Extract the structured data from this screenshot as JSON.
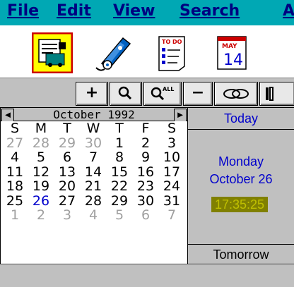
{
  "menu": {
    "items": [
      {
        "label": "File"
      },
      {
        "label": "Edit"
      },
      {
        "label": "View"
      },
      {
        "label": "Search"
      },
      {
        "label": "A"
      }
    ]
  },
  "icons": [
    {
      "name": "scheduler-icon",
      "selected": true
    },
    {
      "name": "phone-book-icon",
      "selected": false
    },
    {
      "name": "todo-list-icon",
      "label": "TO DO",
      "selected": false
    },
    {
      "name": "calendar-page-icon",
      "label_top": "MAY",
      "label_day": "14",
      "selected": false
    }
  ],
  "toolbar": {
    "buttons": [
      {
        "name": "add-button",
        "glyph": "+"
      },
      {
        "name": "find-button",
        "glyph": "🔍"
      },
      {
        "name": "find-all-button",
        "glyph": "ALL"
      },
      {
        "name": "delete-button",
        "glyph": "−"
      },
      {
        "name": "link-button",
        "glyph": "link"
      },
      {
        "name": "partial-button",
        "glyph": "▮"
      }
    ]
  },
  "calendar": {
    "month_label": "October 1992",
    "prev_glyph": "◄",
    "next_glyph": "►",
    "weekdays": [
      "S",
      "M",
      "T",
      "W",
      "T",
      "F",
      "S"
    ],
    "weeks": [
      [
        {
          "d": "27",
          "dim": true
        },
        {
          "d": "28",
          "dim": true
        },
        {
          "d": "29",
          "dim": true
        },
        {
          "d": "30",
          "dim": true
        },
        {
          "d": "1"
        },
        {
          "d": "2"
        },
        {
          "d": "3"
        }
      ],
      [
        {
          "d": "4"
        },
        {
          "d": "5"
        },
        {
          "d": "6"
        },
        {
          "d": "7"
        },
        {
          "d": "8"
        },
        {
          "d": "9"
        },
        {
          "d": "10"
        }
      ],
      [
        {
          "d": "11"
        },
        {
          "d": "12"
        },
        {
          "d": "13"
        },
        {
          "d": "14"
        },
        {
          "d": "15"
        },
        {
          "d": "16"
        },
        {
          "d": "17"
        }
      ],
      [
        {
          "d": "18"
        },
        {
          "d": "19"
        },
        {
          "d": "20"
        },
        {
          "d": "21"
        },
        {
          "d": "22"
        },
        {
          "d": "23"
        },
        {
          "d": "24"
        }
      ],
      [
        {
          "d": "25"
        },
        {
          "d": "26",
          "hl": true
        },
        {
          "d": "27"
        },
        {
          "d": "28"
        },
        {
          "d": "29"
        },
        {
          "d": "30"
        },
        {
          "d": "31"
        }
      ],
      [
        {
          "d": "1",
          "dim": true
        },
        {
          "d": "2",
          "dim": true
        },
        {
          "d": "3",
          "dim": true
        },
        {
          "d": "4",
          "dim": true
        },
        {
          "d": "5",
          "dim": true
        },
        {
          "d": "6",
          "dim": true
        },
        {
          "d": "7",
          "dim": true
        }
      ]
    ]
  },
  "today": {
    "header": "Today",
    "weekday": "Monday",
    "date": "October 26",
    "time": "17:35:25"
  },
  "tomorrow": {
    "header": "Tomorrow"
  },
  "colors": {
    "menubar": "#00a8b4",
    "menu_text": "#000080",
    "highlight": "#0000cc",
    "time_bg": "#808000",
    "time_fg": "#c0c000"
  }
}
